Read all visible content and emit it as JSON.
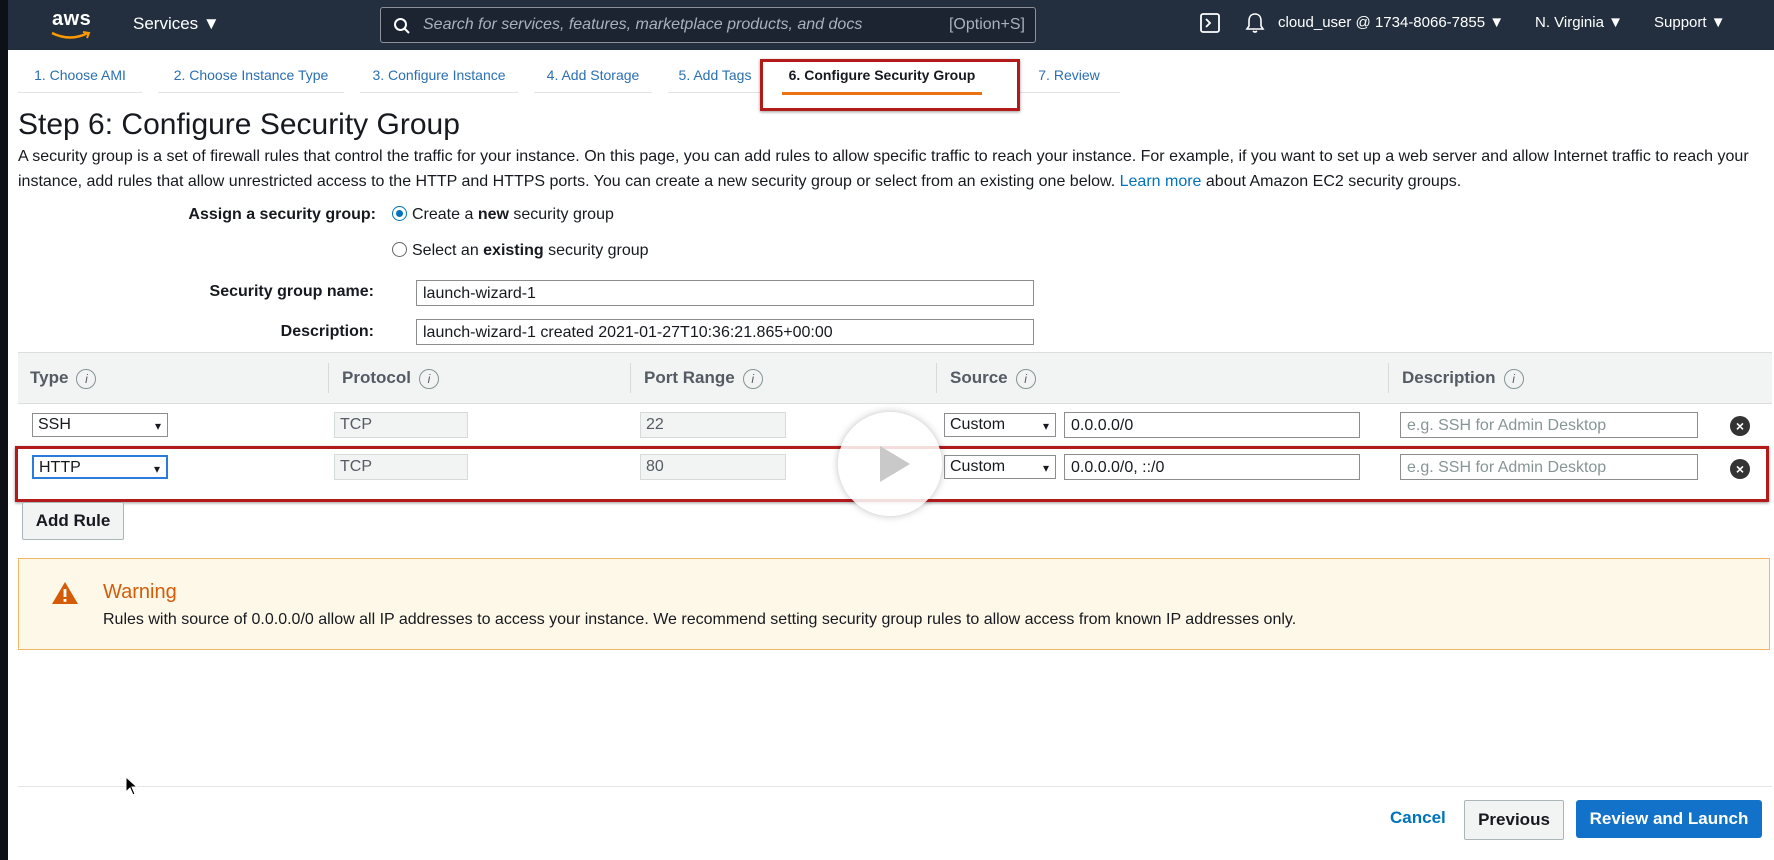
{
  "topnav": {
    "logo_text": "aws",
    "services_label": "Services ▼",
    "search_placeholder": "Search for services, features, marketplace products, and docs",
    "search_shortcut": "[Option+S]",
    "account_label": "cloud_user @ 1734-8066-7855 ▼",
    "region_label": "N. Virginia ▼",
    "support_label": "Support ▼",
    "terminal_icon": "cloudshell-icon",
    "bell_icon": "bell-icon"
  },
  "steps": [
    {
      "label": "1. Choose AMI"
    },
    {
      "label": "2. Choose Instance Type"
    },
    {
      "label": "3. Configure Instance"
    },
    {
      "label": "4. Add Storage"
    },
    {
      "label": "5. Add Tags"
    },
    {
      "label": "6. Configure Security Group",
      "active": true
    },
    {
      "label": "7. Review"
    }
  ],
  "page": {
    "title": "Step 6: Configure Security Group",
    "intro_text": "A security group is a set of firewall rules that control the traffic for your instance. On this page, you can add rules to allow specific traffic to reach your instance. For example, if you want to set up a web server and allow Internet traffic to reach your instance, add rules that allow unrestricted access to the HTTP and HTTPS ports. You can create a new security group or select from an existing one below.",
    "learn_more": "Learn more",
    "intro_suffix": "about Amazon EC2 security groups."
  },
  "form": {
    "assign_label": "Assign a security group:",
    "option_new_pre": "Create a ",
    "option_new_bold": "new",
    "option_new_post": " security group",
    "option_existing_pre": "Select an ",
    "option_existing_bold": "existing",
    "option_existing_post": " security group",
    "name_label": "Security group name:",
    "name_value": "launch-wizard-1",
    "desc_label": "Description:",
    "desc_value": "launch-wizard-1 created 2021-01-27T10:36:21.865+00:00"
  },
  "table": {
    "headers": [
      "Type",
      "Protocol",
      "Port Range",
      "Source",
      "Description"
    ],
    "info_glyph": "i",
    "rows": [
      {
        "type": "SSH",
        "protocol": "TCP",
        "port": "22",
        "source_mode": "Custom",
        "source": "0.0.0.0/0",
        "desc_placeholder": "e.g. SSH for Admin Desktop"
      },
      {
        "type": "HTTP",
        "protocol": "TCP",
        "port": "80",
        "source_mode": "Custom",
        "source": "0.0.0.0/0, ::/0",
        "desc_placeholder": "e.g. SSH for Admin Desktop"
      }
    ],
    "add_rule": "Add Rule"
  },
  "warning": {
    "title": "Warning",
    "message": "Rules with source of 0.0.0.0/0 allow all IP addresses to access your instance. We recommend setting security group rules to allow access from known IP addresses only."
  },
  "footer": {
    "cancel": "Cancel",
    "previous": "Previous",
    "review_launch": "Review and Launch"
  },
  "colors": {
    "nav_bg": "#232f3e",
    "link": "#0073bb",
    "highlight": "#b31b1b",
    "active_tab": "#ec7211",
    "primary": "#1272c9",
    "warning_text": "#d45b07"
  }
}
